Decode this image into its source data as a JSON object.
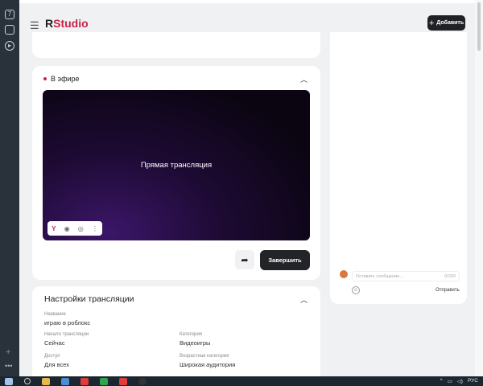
{
  "app": {
    "logo_r": "R",
    "logo_studio": "Studio"
  },
  "header": {
    "add_label": "Добавить"
  },
  "live": {
    "title": "В эфире",
    "video_text": "Прямая трансляция",
    "end_label": "Завершить"
  },
  "settings": {
    "title": "Настройки трансляции",
    "fields": [
      {
        "label": "Название",
        "value": "играю в роблокс"
      },
      {
        "label": "Начало трансляции",
        "value": "Сейчас"
      },
      {
        "label": "Категория",
        "value": "Видеоигры"
      },
      {
        "label": "Доступ",
        "value": "Для всех"
      },
      {
        "label": "Возрастная категория",
        "value": "Широкая аудитория"
      }
    ]
  },
  "chat": {
    "placeholder": "Оставить сообщение...",
    "counter": "0/200",
    "send_label": "Отправить"
  },
  "taskbar": {
    "lang": "РУС"
  },
  "colors": {
    "accent": "#c8234b",
    "dark": "#1f2124"
  }
}
